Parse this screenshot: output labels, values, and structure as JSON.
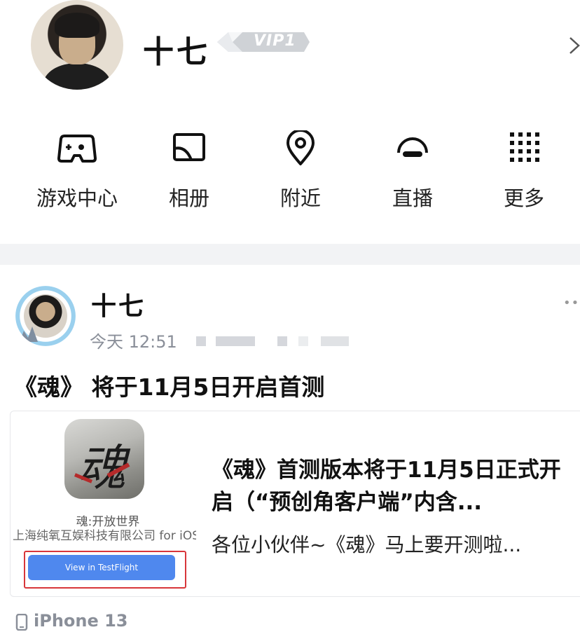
{
  "profile": {
    "name": "十七",
    "vip_label": "VIP1"
  },
  "quick_menu": [
    {
      "label": "游戏中心",
      "icon": "gamepad-icon"
    },
    {
      "label": "相册",
      "icon": "photo-album-icon"
    },
    {
      "label": "附近",
      "icon": "location-pin-icon"
    },
    {
      "label": "直播",
      "icon": "live-icon"
    },
    {
      "label": "更多",
      "icon": "grid-more-icon"
    }
  ],
  "post": {
    "author": "十七",
    "time": "今天 12:51",
    "more_icon": "••",
    "title": "《魂》 将于11月5日开启首测",
    "card": {
      "app_name": "魂:开放世界",
      "company": "上海纯氧互娱科技有限公司 for iOS",
      "button_label": "View in TestFlight",
      "title": "《魂》首测版本将于11月5日正式开启（“预创角客户端”内含...",
      "description": "各位小伙伴~《魂》马上要开测啦..."
    },
    "device": "iPhone 13"
  },
  "colors": {
    "accent_blue": "#4f88ee",
    "highlight_red": "#d8363a",
    "divider": "#f2f3f5",
    "muted_text": "#8a8f99"
  }
}
